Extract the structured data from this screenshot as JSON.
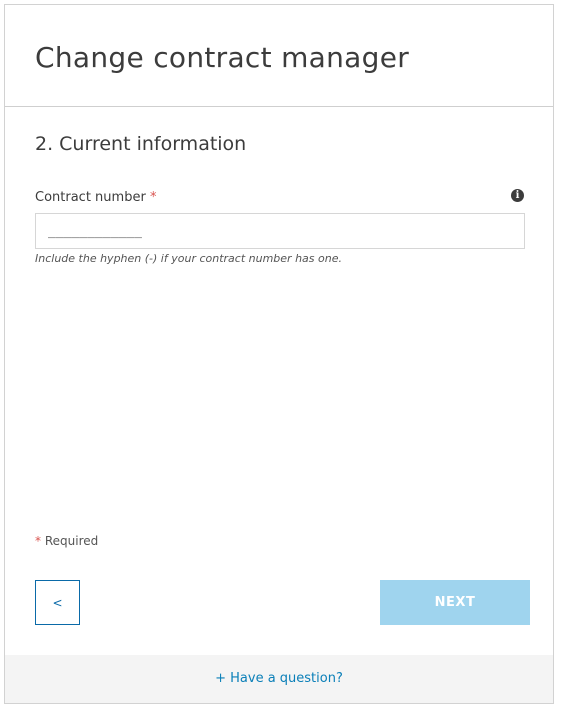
{
  "header": {
    "title": "Change contract manager"
  },
  "section": {
    "title": "2. Current information"
  },
  "contract_number": {
    "label": "Contract number",
    "required_marker": "*",
    "placeholder": "____________",
    "value": "",
    "hint": "Include the hyphen (-) if your contract number has one.",
    "info_icon": "info-icon"
  },
  "form": {
    "required_marker": "*",
    "required_label": "Required"
  },
  "buttons": {
    "back_label": "<",
    "next_label": "NEXT",
    "next_enabled": false
  },
  "footer": {
    "question_link": "+ Have a question?"
  },
  "colors": {
    "accent": "#0a7fb8",
    "next_disabled_bg": "#9fd4ee",
    "required_star": "#d9534f",
    "footer_bg": "#f4f4f4"
  }
}
